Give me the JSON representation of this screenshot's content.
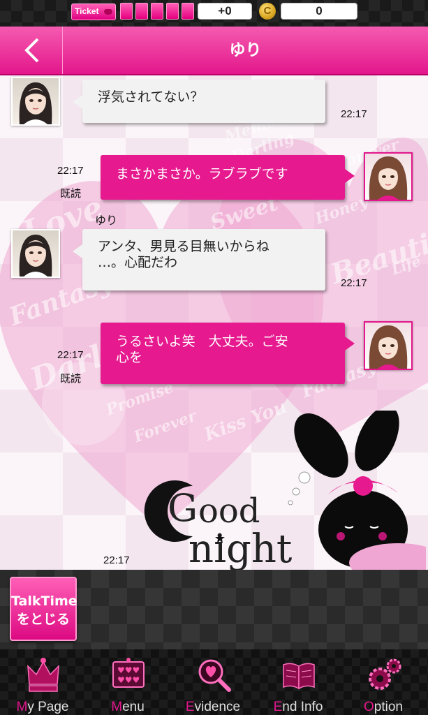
{
  "topbar": {
    "ticket_label": "Ticket",
    "ticket_slots": 5,
    "ticket_change": "+0",
    "coin_icon": "C",
    "coins": "0"
  },
  "header": {
    "back_icon": "<",
    "title": "ゆり"
  },
  "messages": [
    {
      "sender": "ゆり",
      "side": "left",
      "text_lines": [
        "浮気されてない？"
      ],
      "time": "22:17"
    },
    {
      "sender": "me",
      "side": "right",
      "text_lines": [
        "まさかまさか。ラブラブです"
      ],
      "time": "22:17",
      "read": "既読"
    },
    {
      "sender_label": "ゆり",
      "sender": "ゆり",
      "side": "left",
      "text_lines": [
        "アンタ、男見る目無いからね",
        "…。心配だわ"
      ],
      "time": "22:17"
    },
    {
      "sender": "me",
      "side": "right",
      "text_lines": [
        "うるさいよ笑　大丈夫。ご安",
        "心を"
      ],
      "time": "22:17",
      "read": "既読"
    },
    {
      "sender": "me",
      "side": "right",
      "type": "stamp",
      "stamp_text_1": "ood",
      "stamp_text_2": "night",
      "stamp_g": "G",
      "time": "22:17"
    }
  ],
  "bg_words": [
    "Memory",
    "Darling",
    "Forever",
    "Sweet",
    "Beautiful",
    "Love",
    "Fate",
    "Honey",
    "Fantasy",
    "Promise",
    "Kiss You",
    "Life",
    "Dream"
  ],
  "controls": {
    "talktime_line1": "TalkTime",
    "talktime_line2": "をとじる"
  },
  "nav": [
    {
      "first": "M",
      "rest": "y Page",
      "icon": "crown-icon"
    },
    {
      "first": "M",
      "rest": "enu",
      "icon": "menu-hearts-icon"
    },
    {
      "first": "E",
      "rest": "vidence",
      "icon": "magnifier-heart-icon"
    },
    {
      "first": "E",
      "rest": "nd Info",
      "icon": "book-icon"
    },
    {
      "first": "O",
      "rest": "ption",
      "icon": "gears-icon"
    }
  ],
  "colors": {
    "accent": "#e3168c",
    "bubble_out": "#e6198e",
    "bubble_in": "#f2f2f2"
  }
}
